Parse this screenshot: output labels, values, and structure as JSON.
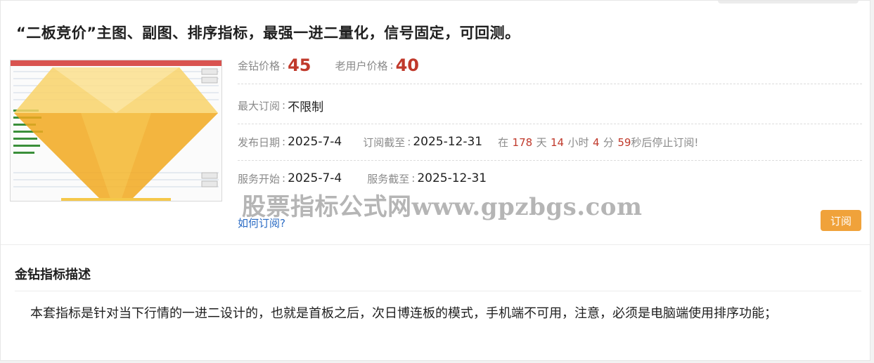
{
  "product": {
    "title": "“二板竞价”主图、副图、排序指标，最强一进二量化，信号固定，可回测。",
    "diamond_price_label": "金钻价格",
    "diamond_price": "45",
    "old_user_price_label": "老用户价格",
    "old_user_price": "40",
    "max_subscription_label": "最大订阅",
    "max_subscription": "不限制",
    "publish_date_label": "发布日期",
    "publish_date": "2025-7-4",
    "subscription_end_label": "订阅截至",
    "subscription_end": "2025-12-31",
    "countdown": {
      "prefix": "在",
      "days": "178",
      "days_unit": "天",
      "hours": "14",
      "hours_unit": "小时",
      "minutes": "4",
      "minutes_unit": "分",
      "seconds": "59",
      "suffix": "秒后停止订阅!"
    },
    "service_start_label": "服务开始",
    "service_start": "2025-7-4",
    "service_end_label": "服务截至",
    "service_end": "2025-12-31",
    "separator": ":",
    "how_to_subscribe": "如何订阅?",
    "subscribe_button": "订阅"
  },
  "watermark": "股票指标公式网www.gpzbgs.com",
  "description": {
    "title": "金钻指标描述",
    "text": "本套指标是针对当下行情的一进二设计的，也就是首板之后，次日博连板的模式，手机端不可用，注意，必须是电脑端使用排序功能；"
  },
  "colors": {
    "price": "#c0392b",
    "subscribe_button": "#f0a23a",
    "link": "#2a6bc4",
    "diamond": "#f5b82e"
  },
  "icons": {
    "thumbnail": "diamond-icon"
  }
}
